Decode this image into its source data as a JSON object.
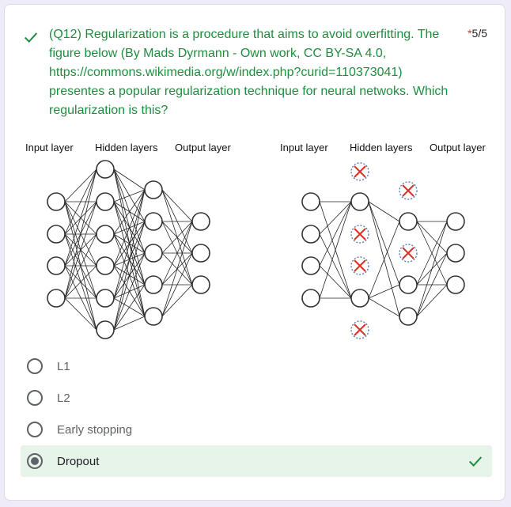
{
  "question": {
    "text": "(Q12)  Regularization is a procedure that aims to avoid overfitting. The figure below (By Mads Dyrmann - Own work, CC BY-SA 4.0, https://commons.wikimedia.org/w/index.php?curid=110373041) presentes a popular regularization technique for neural netwoks. Which regularization is this?",
    "required_mark": "*",
    "score": "5/5",
    "correct": true
  },
  "figure": {
    "left_labels": {
      "input": "Input layer",
      "hidden": "Hidden layers",
      "output": "Output layer"
    },
    "right_labels": {
      "input": "Input layer",
      "hidden": "Hidden layers",
      "output": "Output layer"
    },
    "icon": "neural-network-dropout-diagram"
  },
  "options": [
    {
      "label": "L1",
      "selected": false
    },
    {
      "label": "L2",
      "selected": false
    },
    {
      "label": "Early stopping",
      "selected": false
    },
    {
      "label": "Dropout",
      "selected": true,
      "correct": true
    }
  ],
  "colors": {
    "correct_green": "#1e8e3e",
    "selected_bg": "#e6f4ea",
    "dropped_x": "#d93025"
  }
}
